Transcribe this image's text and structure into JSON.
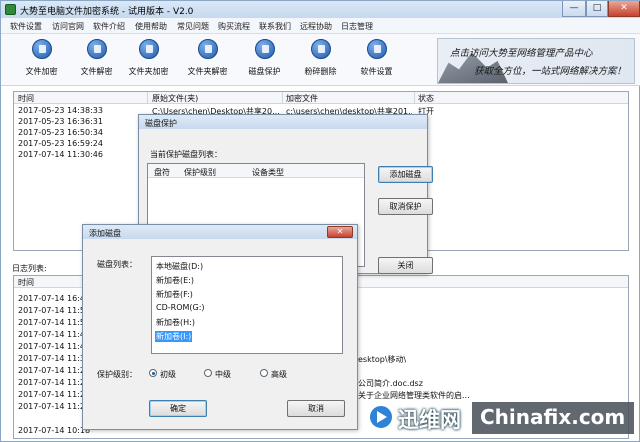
{
  "window": {
    "title": "大势至电脑文件加密系统 - 试用版本 - V2.0",
    "minimize": "—",
    "maximize": "□",
    "close": "✕"
  },
  "menu": [
    "软件设置",
    "访问官网",
    "软件介绍",
    "使用帮助",
    "常见问题",
    "购买流程",
    "联系我们",
    "远程协助",
    "日志管理"
  ],
  "toolbar": [
    {
      "label": "文件加密",
      "icon": "file-lock-icon"
    },
    {
      "label": "文件解密",
      "icon": "file-unlock-icon"
    },
    {
      "label": "文件夹加密",
      "icon": "folder-lock-icon"
    },
    {
      "label": "文件夹解密",
      "icon": "folder-unlock-icon"
    },
    {
      "label": "磁盘保护",
      "icon": "disk-protect-icon"
    },
    {
      "label": "粉碎删除",
      "icon": "shred-icon"
    },
    {
      "label": "软件设置",
      "icon": "settings-icon"
    }
  ],
  "banner": {
    "line1": "点击访问大势至网络管理产品中心",
    "line2": "获取全方位，一站式网络解决方案！"
  },
  "file_table": {
    "columns": [
      "时间",
      "原始文件(夹)",
      "加密文件",
      "状态"
    ],
    "rows": [
      [
        "2017-05-23 14:38:33",
        "C:\\Users\\chen\\Desktop\\共享20...",
        "c:\\users\\chen\\desktop\\共享201...",
        "打开"
      ],
      [
        "2017-05-23 16:36:31",
        "",
        "",
        ""
      ],
      [
        "2017-05-23 16:50:34",
        "",
        "",
        ""
      ],
      [
        "2017-05-23 16:59:24",
        "",
        "",
        ""
      ],
      [
        "2017-07-14 11:30:46",
        "",
        "",
        ""
      ]
    ]
  },
  "log": {
    "label": "日志列表:",
    "column": "时间",
    "rows": [
      "2017-07-14 16:47",
      "2017-07-14 11:51",
      "2017-07-14 11:51",
      "2017-07-14 11:48",
      "2017-07-14 11:47",
      "2017-07-14 11:30",
      "2017-07-14 11:26",
      "2017-07-14 11:26",
      "2017-07-14 11:25",
      "2017-07-14 11:24",
      "2017-07-14 10:18"
    ],
    "fragments": [
      "esktop\\移动\\",
      "公司简介.doc.dsz",
      "关于企业网络管理类软件的启..."
    ]
  },
  "disk_protect_dialog": {
    "title": "磁盘保护",
    "list_label": "当前保护磁盘列表：",
    "columns": [
      "盘符",
      "保护级别",
      "设备类型"
    ],
    "add_button": "添加磁盘",
    "cancel_button": "取消保护",
    "close_button": "关闭"
  },
  "add_disk_dialog": {
    "title": "添加磁盘",
    "close": "✕",
    "list_label": "磁盘列表：",
    "disks": [
      "本地磁盘(D:)",
      "新加卷(E:)",
      "新加卷(F:)",
      "CD-ROM(G:)",
      "新加卷(H:)",
      "新加卷(I:)"
    ],
    "selected_index": 5,
    "level_label": "保护级别：",
    "levels": [
      "初级",
      "中级",
      "高级"
    ],
    "selected_level": 0,
    "ok_button": "确定",
    "cancel_button": "取消"
  },
  "watermark": {
    "cn": "迅维网",
    "en": "Chinafix.com"
  }
}
